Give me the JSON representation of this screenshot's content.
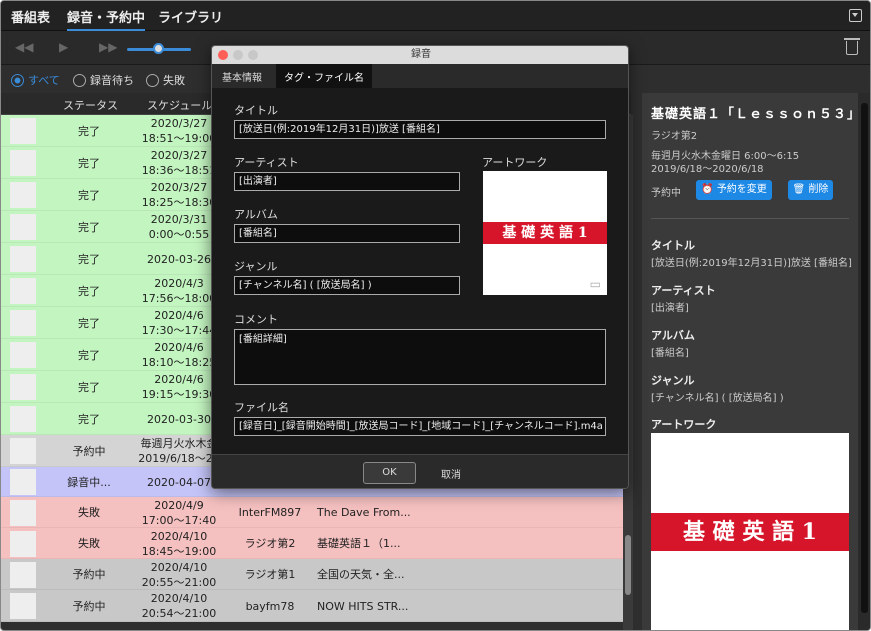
{
  "tabs": [
    "番組表",
    "録音・予約中",
    "ライブラリ"
  ],
  "filters": [
    {
      "label": "すべて",
      "selected": true
    },
    {
      "label": "録音待ち",
      "selected": false
    },
    {
      "label": "失敗",
      "selected": false
    }
  ],
  "table": {
    "headers": [
      "ステータス",
      "スケジュール"
    ],
    "rows": [
      {
        "status": "完了",
        "time1": "2020/3/27",
        "time2": "18:51〜19:00",
        "station": "",
        "program": "",
        "bg": "#c3f5c0"
      },
      {
        "status": "完了",
        "time1": "2020/3/27",
        "time2": "18:36〜18:51",
        "station": "",
        "program": "",
        "bg": "#c3f5c0"
      },
      {
        "status": "完了",
        "time1": "2020/3/27",
        "time2": "18:25〜18:30",
        "station": "",
        "program": "",
        "bg": "#c3f5c0"
      },
      {
        "status": "完了",
        "time1": "2020/3/31",
        "time2": "0:00〜0:55",
        "station": "",
        "program": "",
        "bg": "#c3f5c0"
      },
      {
        "status": "完了",
        "time1": "2020-03-26",
        "time2": "",
        "station": "",
        "program": "",
        "bg": "#c3f5c0"
      },
      {
        "status": "完了",
        "time1": "2020/4/3",
        "time2": "17:56〜18:00",
        "station": "",
        "program": "",
        "bg": "#c3f5c0"
      },
      {
        "status": "完了",
        "time1": "2020/4/6",
        "time2": "17:30〜17:44",
        "station": "",
        "program": "",
        "bg": "#c3f5c0"
      },
      {
        "status": "完了",
        "time1": "2020/4/6",
        "time2": "18:10〜18:25",
        "station": "",
        "program": "",
        "bg": "#c3f5c0"
      },
      {
        "status": "完了",
        "time1": "2020/4/6",
        "time2": "19:15〜19:30",
        "station": "",
        "program": "",
        "bg": "#c3f5c0"
      },
      {
        "status": "完了",
        "time1": "2020-03-30",
        "time2": "",
        "station": "",
        "program": "",
        "bg": "#c3f5c0"
      },
      {
        "status": "予約中",
        "time1": "毎週月火水木金",
        "time2": "2019/6/18〜20",
        "station": "",
        "program": "",
        "bg": "#d4d4d4"
      },
      {
        "status": "録音中...",
        "time1": "2020-04-07",
        "time2": "",
        "station": "",
        "program": "",
        "bg": "#c4c4f8"
      },
      {
        "status": "失敗",
        "time1": "2020/4/9",
        "time2": "17:00〜17:40",
        "station": "InterFM897",
        "program": "The Dave From...",
        "bg": "#f5c0c0"
      },
      {
        "status": "失敗",
        "time1": "2020/4/10",
        "time2": "18:45〜19:00",
        "station": "ラジオ第2",
        "program": "基礎英語１（1...",
        "bg": "#f5c0c0"
      },
      {
        "status": "予約中",
        "time1": "2020/4/10",
        "time2": "20:55〜21:00",
        "station": "ラジオ第1",
        "program": "全国の天気・全...",
        "bg": "#c8c8c8"
      },
      {
        "status": "予約中",
        "time1": "2020/4/10",
        "time2": "20:54〜21:00",
        "station": "bayfm78",
        "program": "NOW HITS STR...",
        "bg": "#c8c8c8"
      }
    ]
  },
  "dialog": {
    "title": "録音",
    "tabs": [
      "基本情報",
      "タグ・ファイル名"
    ],
    "title_label": "タイトル",
    "title_value": "[放送日(例:2019年12月31日)]放送 [番組名]",
    "artist_label": "アーティスト",
    "artist_value": "[出演者]",
    "album_label": "アルバム",
    "album_value": "[番組名]",
    "genre_label": "ジャンル",
    "genre_value": "[チャンネル名] ( [放送局名] )",
    "artwork_label": "アートワーク",
    "artwork_text": "基 礎 英 語 1",
    "comment_label": "コメント",
    "comment_value": "[番組詳細]",
    "filename_label": "ファイル名",
    "filename_value": "[録音日]_[録音開始時間]_[放送局コード]_[地域コード]_[チャンネルコード].m4a",
    "ok": "OK",
    "cancel": "取消"
  },
  "detail": {
    "title": "基礎英語１「Ｌｅｓｓｏｎ５３」",
    "station": "ラジオ第2",
    "schedule1": "毎週月火水木金曜日 6:00〜6:15",
    "schedule2": "2019/6/18〜2020/6/18",
    "status": "予約中",
    "change_button": "予約を変更",
    "delete_button": "削除",
    "title_label": "タイトル",
    "title_value": "[放送日(例:2019年12月31日)]放送 [番組名]",
    "artist_label": "アーティスト",
    "artist_value": "[出演者]",
    "album_label": "アルバム",
    "album_value": "[番組名]",
    "genre_label": "ジャンル",
    "genre_value": "[チャンネル名] ( [放送局名] )",
    "artwork_label": "アートワーク",
    "artwork_text": "基 礎 英 語 1"
  },
  "colors": {
    "accent": "#3a8bd8",
    "brand_red": "#d7152a",
    "button_blue": "#1e88e5"
  }
}
